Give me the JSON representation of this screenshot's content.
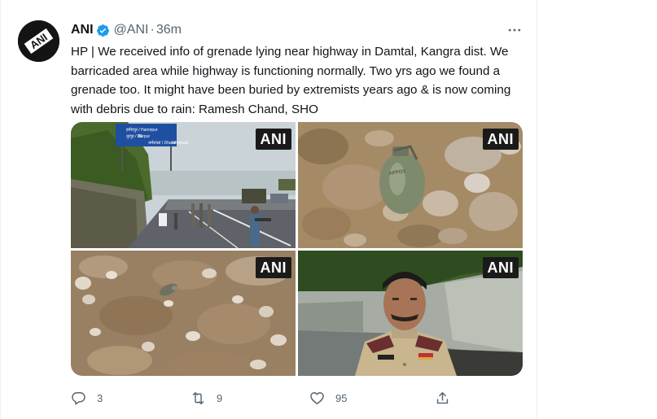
{
  "tweet": {
    "author_name": "ANI",
    "handle": "@ANI",
    "separator": "·",
    "time": "36m",
    "avatar_logo_text": "ANI",
    "text": "HP | We received info of grenade lying near highway in Damtal, Kangra dist. We barricaded area while highway is functioning normally. Two yrs ago we found a grenade too. It might have been buried by extremists years ago & is now coming with debris due to rain: Ramesh Chand, SHO",
    "more_icon": "more-icon",
    "verified_icon": "verified-badge-icon"
  },
  "media": {
    "watermark": "ANI",
    "signboard_lines": [
      "हमीरपुर / Hamirpur",
      "नूरपुर / Nurpur",
      "धर्मशाला / Dharamshala"
    ],
    "signboard_numbers": [
      "20",
      "64"
    ],
    "photos": [
      {
        "id": "highway"
      },
      {
        "id": "grenade-closeup"
      },
      {
        "id": "debris"
      },
      {
        "id": "officer"
      }
    ]
  },
  "actions": {
    "reply": {
      "icon": "reply-icon",
      "count": "3"
    },
    "retweet": {
      "icon": "retweet-icon",
      "count": "9"
    },
    "like": {
      "icon": "heart-icon",
      "count": "95"
    },
    "share": {
      "icon": "share-icon",
      "count": ""
    }
  },
  "colors": {
    "text": "#0f1419",
    "secondary": "#536471",
    "verified": "#1d9bf0",
    "border": "#e6ecf0"
  }
}
